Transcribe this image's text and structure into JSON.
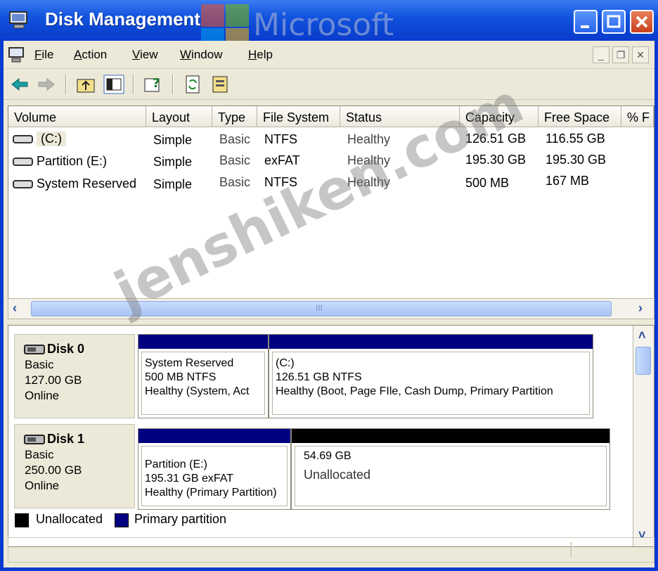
{
  "window": {
    "title": "Disk Management",
    "overlay_text": "Microsoft"
  },
  "menu": {
    "items": [
      "File",
      "Action",
      "View",
      "Window",
      "Help"
    ],
    "mdi_buttons": [
      "_",
      "❐",
      "✕"
    ]
  },
  "toolbar": {
    "icons": [
      "back-arrow-icon",
      "forward-arrow-icon",
      "up-folder-icon",
      "show-hide-tree-icon",
      "help-icon",
      "refresh-icon",
      "properties-icon"
    ]
  },
  "volume_list": {
    "columns": [
      "Volume",
      "Layout",
      "Type",
      "File System",
      "Status",
      "Capacity",
      "Free Space",
      "% F"
    ],
    "rows": [
      {
        "volume": "(C:)",
        "layout": "Simple",
        "type": "Basic",
        "fs": "NTFS",
        "status": "Healthy",
        "capacity": "126.51 GB",
        "free": "116.55 GB"
      },
      {
        "volume": "Partition (E:)",
        "layout": "Simple",
        "type": "Basic",
        "fs": "exFAT",
        "status": "Healthy",
        "capacity": "195.30 GB",
        "free": "195.30 GB"
      },
      {
        "volume": "System Reserved",
        "layout": "Simple",
        "type": "Basic",
        "fs": "NTFS",
        "status": "Healthy",
        "capacity": "500 MB",
        "free": "167 MB"
      }
    ]
  },
  "disks": [
    {
      "name": "Disk 0",
      "type": "Basic",
      "size": "127.00 GB",
      "state": "Online",
      "partitions": [
        {
          "lines": [
            "System Reserved",
            "500 MB NTFS",
            "Healthy (System, Act"
          ],
          "bar_color": "#000080"
        },
        {
          "lines": [
            "(C:)",
            "126.51 GB NTFS",
            "Healthy (Boot, Page FIle, Cash Dump, Primary Partition"
          ],
          "bar_color": "#000080"
        }
      ]
    },
    {
      "name": "Disk 1",
      "type": "Basic",
      "size": "250.00 GB",
      "state": "Online",
      "partitions": [
        {
          "lines": [
            "Partition (E:)",
            "195.31 GB exFAT",
            "Healthy (Primary Partition)"
          ],
          "bar_color": "#000080"
        },
        {
          "lines": [
            "",
            "54.69 GB",
            "Unallocated"
          ],
          "bar_color": "#000000"
        }
      ]
    }
  ],
  "legend": {
    "items": [
      {
        "label": "Unallocated",
        "color": "#000000"
      },
      {
        "label": "Primary partition",
        "color": "#000080"
      }
    ]
  },
  "watermark": "jenshiken.com",
  "scroll": {
    "h_thumb_label": "III"
  }
}
